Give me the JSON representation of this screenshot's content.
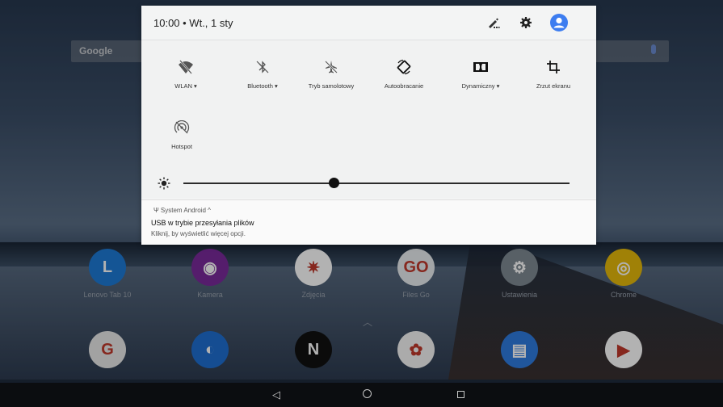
{
  "status": {
    "clock": "10:00 • Wt., 1 sty"
  },
  "google_bar": {
    "logo": "Google"
  },
  "quick_settings": {
    "tiles": [
      {
        "label": "WLAN",
        "icon": "wifi-off-icon",
        "dropdown": true
      },
      {
        "label": "Bluetooth",
        "icon": "bluetooth-off-icon",
        "dropdown": true
      },
      {
        "label": "Tryb samolotowy",
        "icon": "airplane-icon",
        "dropdown": false
      },
      {
        "label": "Autoobracanie",
        "icon": "auto-rotate-icon",
        "dropdown": false
      },
      {
        "label": "Dynamiczny",
        "icon": "dolby-icon",
        "dropdown": true
      },
      {
        "label": "Zrzut ekranu",
        "icon": "crop-screenshot-icon",
        "dropdown": false
      },
      {
        "label": "Hotspot",
        "icon": "hotspot-off-icon",
        "dropdown": false
      }
    ],
    "brightness": 0.39
  },
  "notification": {
    "app": "System Android ^",
    "title": "USB w trybie przesyłania plików",
    "text": "Kliknij, by wyświetlić więcej opcji."
  },
  "apps_row1": [
    {
      "label": "Lenovo Tab 10",
      "color": "#1e7ad6",
      "glyph": "L"
    },
    {
      "label": "Kamera",
      "color": "#7a2a9b",
      "glyph": "◉"
    },
    {
      "label": "Zdjęcia",
      "color": "#ffffff",
      "glyph": "✷"
    },
    {
      "label": "Files Go",
      "color": "#e9ecef",
      "glyph": "GO"
    },
    {
      "label": "Ustawienia",
      "color": "#7f8a93",
      "glyph": "⚙"
    },
    {
      "label": "Chrome",
      "color": "#e5b90b",
      "glyph": "◎"
    }
  ],
  "apps_row2": [
    {
      "label": "",
      "color": "#e8e8e8",
      "glyph": "G"
    },
    {
      "label": "",
      "color": "#1f6fd1",
      "glyph": "◐"
    },
    {
      "label": "",
      "color": "#111111",
      "glyph": "N"
    },
    {
      "label": "",
      "color": "#f5f5f5",
      "glyph": "✿"
    },
    {
      "label": "",
      "color": "#2f7be0",
      "glyph": "▤"
    },
    {
      "label": "",
      "color": "#ffffff",
      "glyph": "▶"
    }
  ],
  "nav": {
    "back": "◁"
  }
}
